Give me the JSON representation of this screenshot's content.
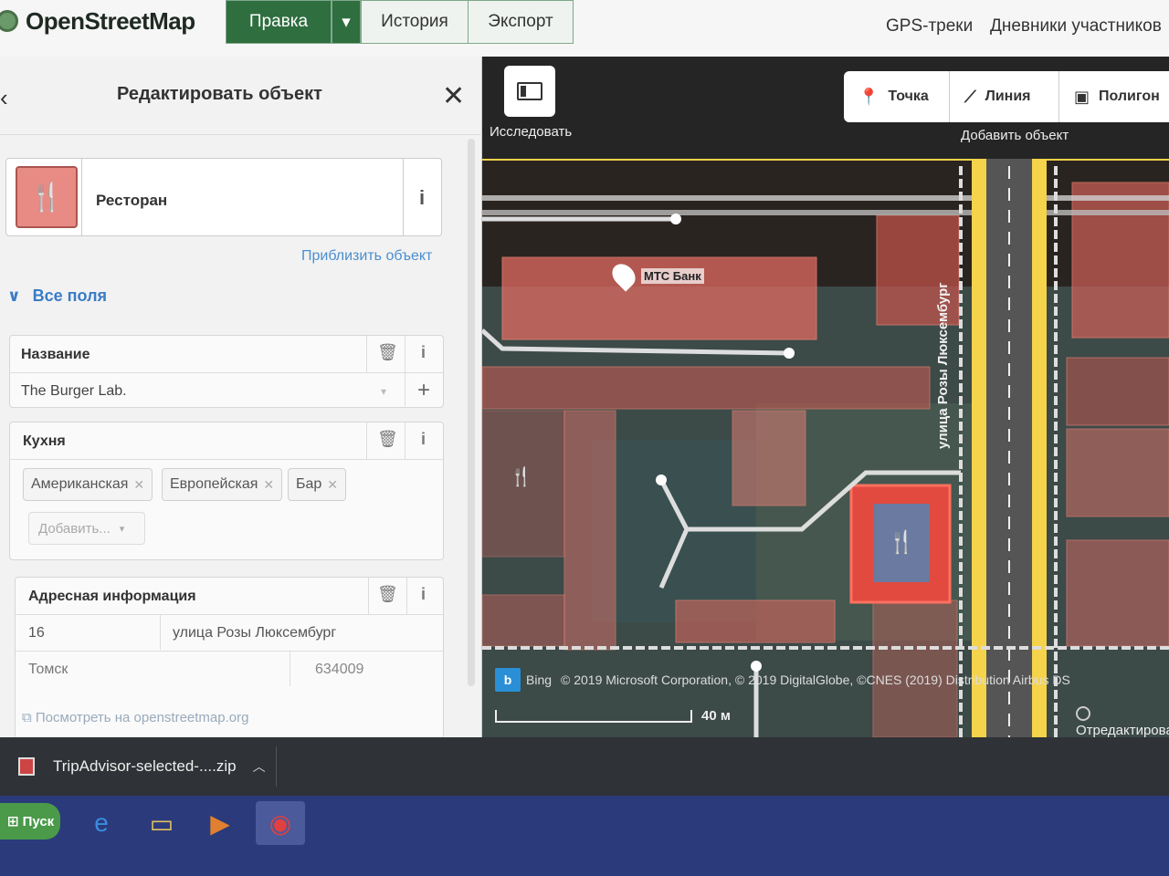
{
  "topbar": {
    "logo": "OpenStreetMap",
    "edit": "Правка",
    "history": "История",
    "export": "Экспорт",
    "gps": "GPS-треки",
    "diaries": "Дневники участников"
  },
  "sidebar": {
    "title": "Редактировать объект",
    "preset_name": "Ресторан",
    "zoom_link": "Приблизить объект",
    "all_fields": "Все поля",
    "fields": {
      "name": {
        "label": "Название",
        "value": "The Burger Lab."
      },
      "cuisine": {
        "label": "Кухня",
        "tags": [
          "Американская",
          "Европейская",
          "Бар"
        ],
        "add_placeholder": "Добавить..."
      },
      "address": {
        "label": "Адресная информация",
        "housenumber": "16",
        "street": "улица Розы Люксембург",
        "city": "Томск",
        "postcode": "634009"
      }
    },
    "view_osm": "Посмотреть на openstreetmap.org"
  },
  "map": {
    "explore": "Исследовать",
    "add_point": "Точка",
    "add_line": "Линия",
    "add_area": "Полигон",
    "add_feature": "Добавить объект",
    "poi_bank": "МТС Банк",
    "street_label": "улица Розы Люксембург",
    "bing": "Bing",
    "credit": "© 2019 Microsoft Corporation, © 2019 DigitalGlobe, ©CNES (2019) Distribution Airbus DS",
    "scale": "40 м",
    "edit_hint": "Отредактировать"
  },
  "downloads": {
    "file": "TripAdvisor-selected-....zip"
  },
  "taskbar": {
    "start": "Пуск"
  },
  "colors": {
    "osm_green": "#2f6e3f",
    "link_blue": "#3a7cc6",
    "building_red": "#e06a60",
    "road_yellow": "#f5d34a"
  }
}
